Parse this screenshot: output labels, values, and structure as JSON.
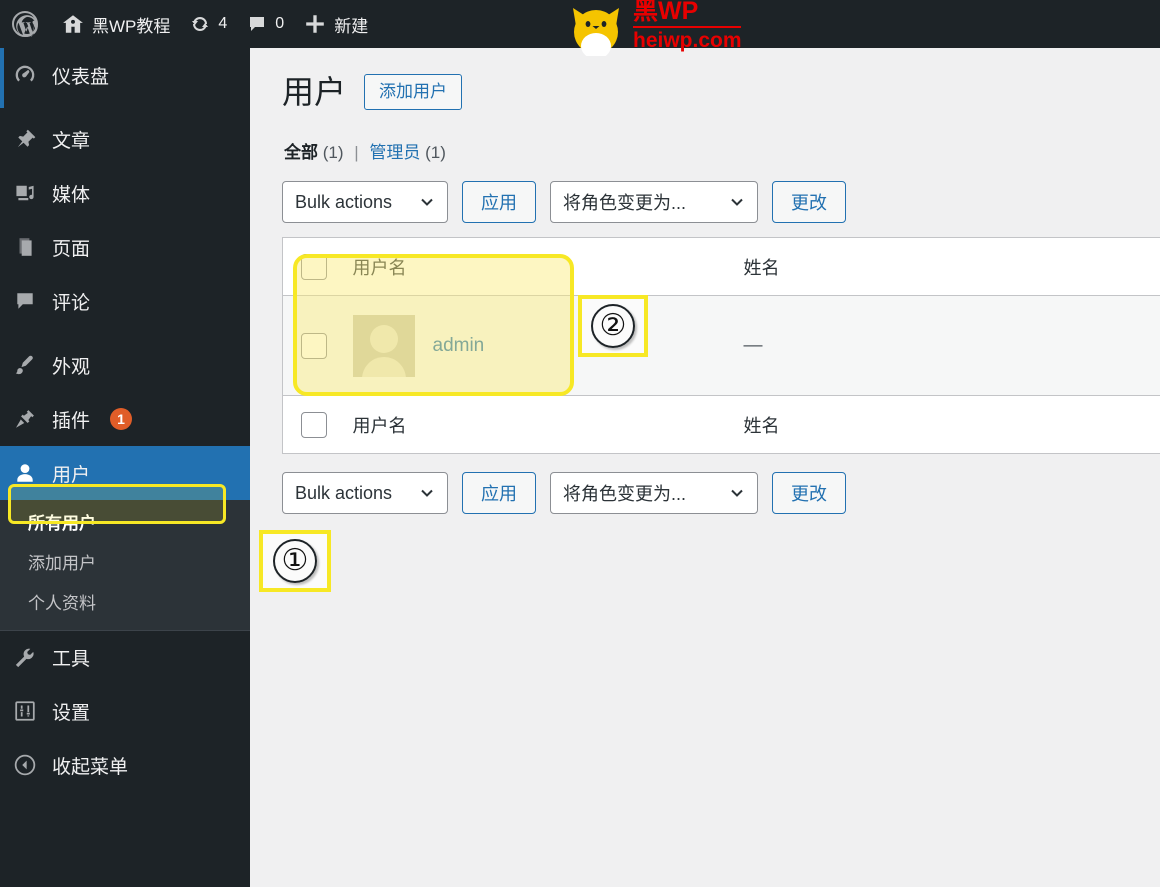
{
  "adminbar": {
    "wp_logo": "W",
    "site_name": "黑WP教程",
    "updates_count": "4",
    "comments_count": "0",
    "new_label": "新建"
  },
  "watermark": {
    "top_text": "黑WP",
    "bottom_text": "heiwp.com",
    "color": "#e80000"
  },
  "sidebar": {
    "items": [
      {
        "label": "仪表盘",
        "icon": "dashboard-icon"
      },
      {
        "label": "文章",
        "icon": "pin-icon"
      },
      {
        "label": "媒体",
        "icon": "media-icon"
      },
      {
        "label": "页面",
        "icon": "page-icon"
      },
      {
        "label": "评论",
        "icon": "comment-icon"
      },
      {
        "label": "外观",
        "icon": "brush-icon"
      },
      {
        "label": "插件",
        "icon": "plugin-icon",
        "badge": "1"
      },
      {
        "label": "用户",
        "icon": "user-icon",
        "current": true
      },
      {
        "label": "工具",
        "icon": "tools-icon"
      },
      {
        "label": "设置",
        "icon": "settings-icon"
      },
      {
        "label": "收起菜单",
        "icon": "collapse-icon"
      }
    ],
    "submenu": [
      {
        "label": "所有用户",
        "current": true
      },
      {
        "label": "添加用户"
      },
      {
        "label": "个人资料"
      }
    ]
  },
  "main": {
    "title": "用户",
    "add_user_button": "添加用户",
    "filters": {
      "all_label": "全部",
      "all_count": "(1)",
      "separator": "|",
      "admin_label": "管理员",
      "admin_count": "(1)"
    },
    "toolbar_top": {
      "bulk_actions": "Bulk actions",
      "apply": "应用",
      "change_role": "将角色变更为...",
      "change": "更改"
    },
    "toolbar_bottom": {
      "bulk_actions": "Bulk actions",
      "apply": "应用",
      "change_role": "将角色变更为...",
      "change": "更改"
    },
    "table": {
      "headers": {
        "username": "用户名",
        "name": "姓名"
      },
      "footers": {
        "username": "用户名",
        "name": "姓名"
      },
      "rows": [
        {
          "username": "admin",
          "name": "—"
        }
      ]
    }
  },
  "annotations": {
    "marker_one": "①",
    "marker_two": "②",
    "highlight_color": "#f7e825"
  }
}
